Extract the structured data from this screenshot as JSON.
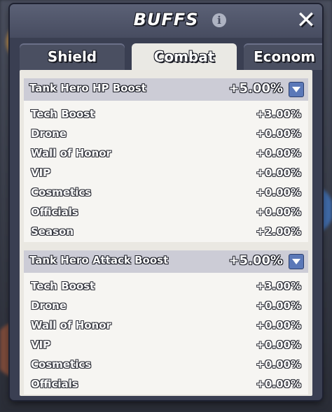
{
  "window": {
    "title": "BUFFS"
  },
  "tabs": [
    {
      "label": "Shield",
      "active": false
    },
    {
      "label": "Combat",
      "active": true
    },
    {
      "label": "Econom",
      "active": false
    }
  ],
  "sections": [
    {
      "title": "Tank Hero HP Boost",
      "total": "+5.00%",
      "rows": [
        {
          "label": "Tech Boost",
          "value": "+3.00%"
        },
        {
          "label": "Drone",
          "value": "+0.00%"
        },
        {
          "label": "Wall of Honor",
          "value": "+0.00%"
        },
        {
          "label": "VIP",
          "value": "+0.00%"
        },
        {
          "label": "Cosmetics",
          "value": "+0.00%"
        },
        {
          "label": "Officials",
          "value": "+0.00%"
        },
        {
          "label": "Season",
          "value": "+2.00%"
        }
      ]
    },
    {
      "title": "Tank Hero Attack Boost",
      "total": "+5.00%",
      "rows": [
        {
          "label": "Tech Boost",
          "value": "+3.00%"
        },
        {
          "label": "Drone",
          "value": "+0.00%"
        },
        {
          "label": "Wall of Honor",
          "value": "+0.00%"
        },
        {
          "label": "VIP",
          "value": "+0.00%"
        },
        {
          "label": "Cosmetics",
          "value": "+0.00%"
        },
        {
          "label": "Officials",
          "value": "+0.00%"
        }
      ]
    }
  ],
  "icons": {
    "info": "info-icon",
    "close": "close-icon",
    "toggle": "chevron-down-icon"
  },
  "colors": {
    "panel": "#3a3f52",
    "content": "#eae8e2",
    "toggle": "#5b78b8"
  }
}
